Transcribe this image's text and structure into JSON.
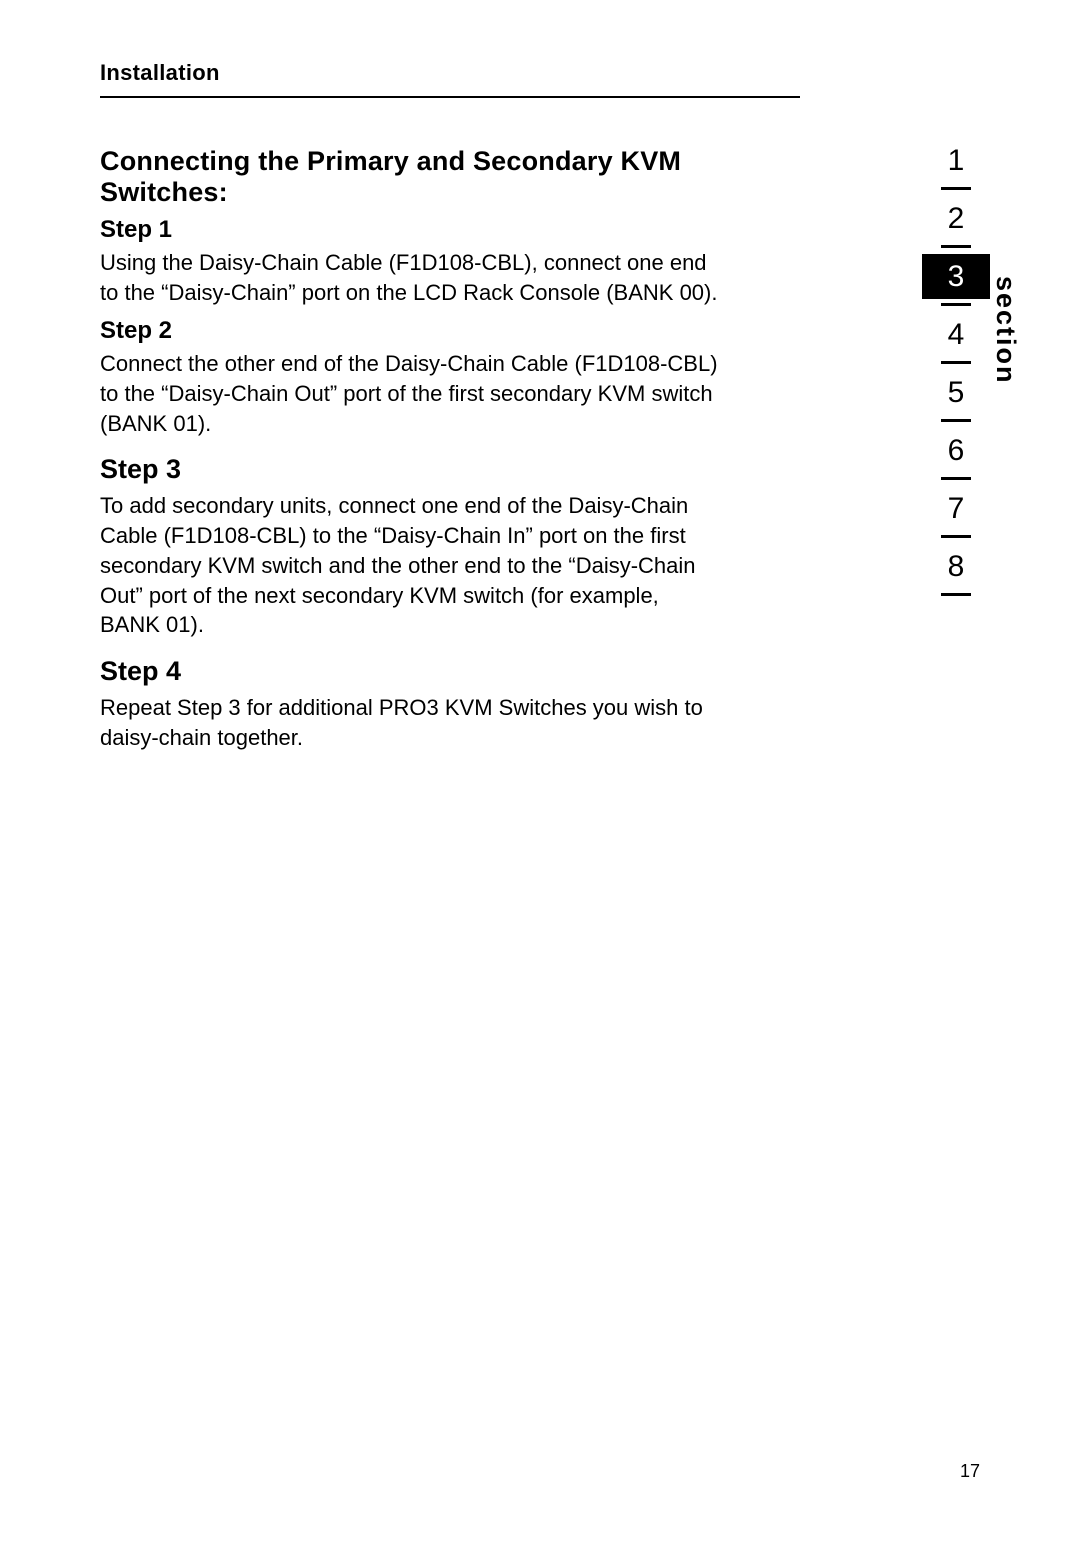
{
  "header": {
    "title": "Installation"
  },
  "content": {
    "main_heading": "Connecting the Primary and Secondary KVM Switches:",
    "steps": [
      {
        "label": "Step 1",
        "big": false,
        "text": "Using the Daisy-Chain Cable (F1D108-CBL), connect one end to the “Daisy-Chain” port on the LCD Rack Console (BANK 00)."
      },
      {
        "label": "Step 2",
        "big": false,
        "text": "Connect the other end of the Daisy-Chain Cable (F1D108-CBL) to the “Daisy-Chain Out” port of the first secondary KVM switch (BANK 01)."
      },
      {
        "label": "Step 3",
        "big": true,
        "text": "To add secondary units, connect one end of the Daisy-Chain Cable (F1D108-CBL) to the “Daisy-Chain In” port on the first secondary KVM switch and the other end to the “Daisy-Chain Out” port of the next secondary KVM switch (for example, BANK 01)."
      },
      {
        "label": "Step 4",
        "big": true,
        "text": "Repeat Step 3 for additional PRO3 KVM Switches you wish to daisy-chain together."
      }
    ]
  },
  "section_nav": {
    "label": "section",
    "items": [
      "1",
      "2",
      "3",
      "4",
      "5",
      "6",
      "7",
      "8"
    ],
    "active_index": 2
  },
  "page_number": "17"
}
